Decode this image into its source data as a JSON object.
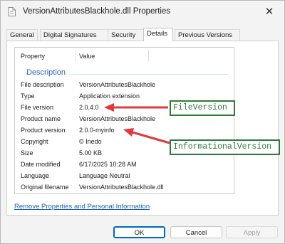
{
  "window": {
    "title": "VersionAttributesBlackhole.dll Properties",
    "close_glyph": "✕"
  },
  "tabs": [
    {
      "label": "General"
    },
    {
      "label": "Digital Signatures"
    },
    {
      "label": "Security"
    },
    {
      "label": "Details"
    },
    {
      "label": "Previous Versions"
    }
  ],
  "details": {
    "col_property": "Property",
    "col_value": "Value",
    "section": "Description",
    "rows": [
      {
        "property": "File description",
        "value": "VersionAttributesBlackhole"
      },
      {
        "property": "Type",
        "value": "Application extension"
      },
      {
        "property": "File version",
        "value": "2.0.4.0"
      },
      {
        "property": "Product name",
        "value": "VersionAttributesBlackhole"
      },
      {
        "property": "Product version",
        "value": "2.0.0-myinfo"
      },
      {
        "property": "Copyright",
        "value": "© Inedo"
      },
      {
        "property": "Size",
        "value": "5.00 KB"
      },
      {
        "property": "Date modified",
        "value": "6/17/2025 10:28 AM"
      },
      {
        "property": "Language",
        "value": "Language Neutral"
      },
      {
        "property": "Original filename",
        "value": "VersionAttributesBlackhole.dll"
      }
    ]
  },
  "annotations": {
    "file_version_label": "FileVersion",
    "informational_version_label": "InformationalVersion",
    "arrow_color": "#e0393e",
    "box_color": "#2f7a3b"
  },
  "link": "Remove Properties and Personal Information",
  "buttons": {
    "ok": "OK",
    "cancel": "Cancel",
    "apply": "Apply"
  }
}
